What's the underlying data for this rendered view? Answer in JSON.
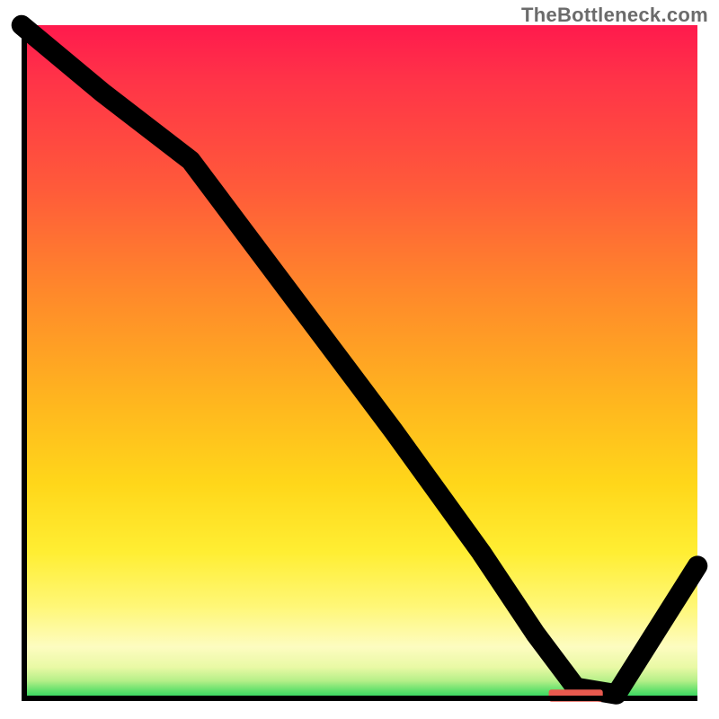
{
  "attribution": "TheBottleneck.com",
  "chart_data": {
    "type": "line",
    "title": "",
    "xlabel": "",
    "ylabel": "",
    "xlim": [
      0,
      100
    ],
    "ylim": [
      0,
      100
    ],
    "background_gradient": {
      "top": "#ff1a4d",
      "mid1": "#ff8a2a",
      "mid2": "#ffee33",
      "low": "#fdfcc0",
      "bottom": "#17cf59"
    },
    "series": [
      {
        "name": "bottleneck-curve",
        "x": [
          0,
          12,
          25,
          40,
          55,
          68,
          76,
          82,
          88,
          100
        ],
        "y": [
          100,
          90,
          80,
          60,
          40,
          22,
          10,
          2,
          1,
          20
        ]
      }
    ],
    "marker": {
      "name": "optimal-range-bar",
      "x_start": 78,
      "x_end": 86,
      "y": 0.8,
      "color": "#e85a4f"
    }
  }
}
